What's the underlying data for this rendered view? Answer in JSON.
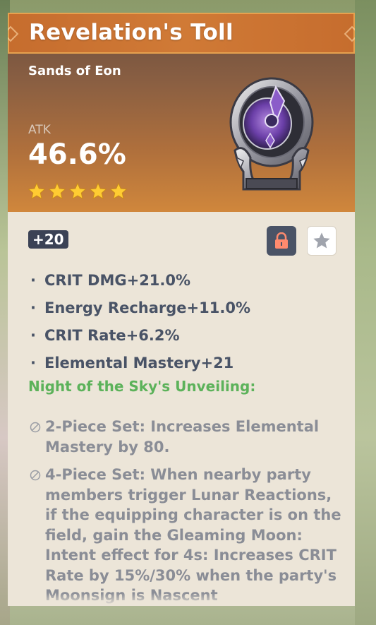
{
  "artifact": {
    "name": "Revelation's Toll",
    "slot": "Sands of Eon",
    "main_stat_label": "ATK",
    "main_stat_value": "46.6%",
    "rarity": 5,
    "level": "+20",
    "locked": true,
    "favorited": false
  },
  "substats": [
    {
      "label": "CRIT DMG+21.0%"
    },
    {
      "label": "Energy Recharge+11.0%"
    },
    {
      "label": "CRIT Rate+6.2%"
    },
    {
      "label": "Elemental Mastery+21"
    }
  ],
  "set": {
    "name": "Night of the Sky's Unveiling:",
    "two_piece": "2-Piece Set: Increases Elemental Mastery by 80.",
    "four_piece": "4-Piece Set: When nearby party members trigger Lunar Reactions, if the equipping character is on the field, gain the Gleaming Moon: Intent effect for 4s: Increases CRIT Rate by 15%/30% when the party's Moonsign is Nascent"
  },
  "colors": {
    "title_bar": "#d07a36",
    "star": "#ffcc32",
    "set_name": "#5cb25a",
    "substat_text": "#495366",
    "set_effect_text": "#8a8d96",
    "lock_bg": "#4a5366",
    "lock_icon": "#ff8a6e"
  },
  "icons": {
    "lock": "lock-icon",
    "favorite": "star-icon",
    "rarity": "star-icon",
    "set_inactive": "circle-slash-icon"
  }
}
